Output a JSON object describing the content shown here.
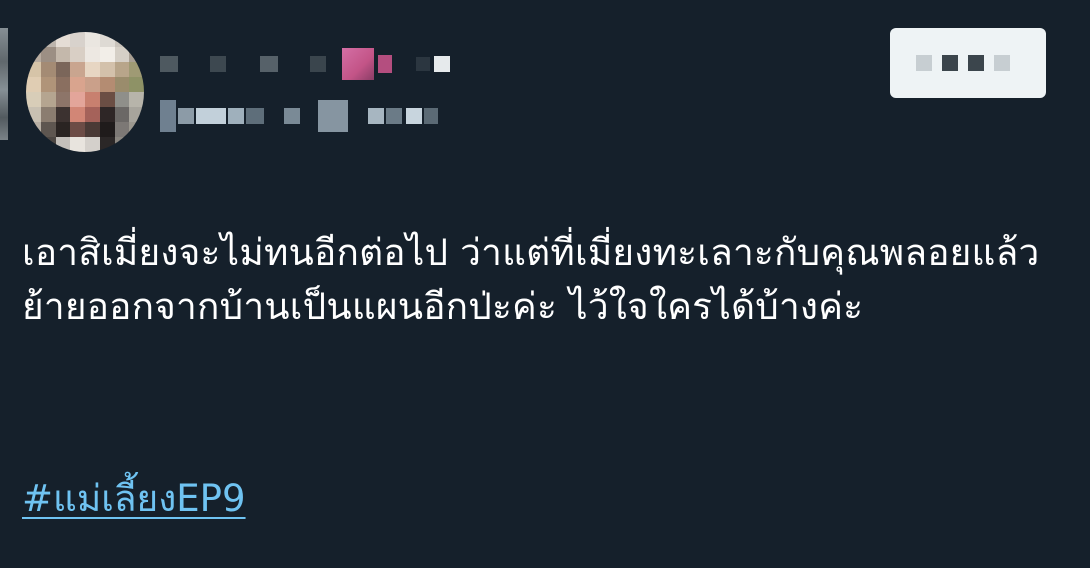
{
  "tweet": {
    "author_avatar": "avatar-pixelated",
    "author_name": "",
    "author_handle": "",
    "follow_button_label": "",
    "text": "เอาสิเมี่ยงจะไม่ทนอีกต่อไป ว่าแต่ที่เมี่ยงทะเลาะกับคุณพลอยแล้วย้ายออกจากบ้านเป็นแผนอีกป่ะค่ะ ไว้ใจใครได้บ้างค่ะ",
    "hashtag": "#แม่เลี้ยงEP9"
  },
  "colors": {
    "background": "#15202b",
    "text": "#ffffff",
    "link": "#6fc3f2",
    "follow_button": "#eef3f5"
  }
}
